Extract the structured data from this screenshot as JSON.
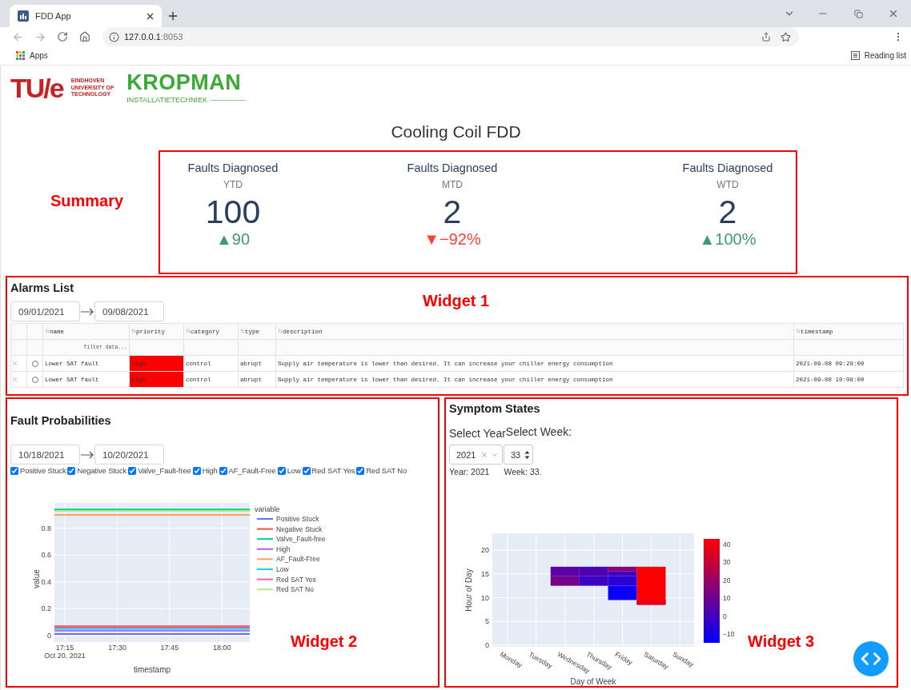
{
  "browser": {
    "tab_title": "FDD App",
    "url_host": "127.0.0.1",
    "url_port": ":8053",
    "bookmark": "Apps",
    "reading_list": "Reading list"
  },
  "header": {
    "tue_mark": "TU/e",
    "tue_lines": [
      "EINDHOVEN",
      "UNIVERSITY OF",
      "TECHNOLOGY"
    ],
    "kropman_name": "KROPMAN",
    "kropman_tagline": "INSTALLATIETECHNIEK"
  },
  "title": "Cooling Coil FDD",
  "summary": {
    "annotation": "Summary",
    "cards": [
      {
        "label": "Faults Diagnosed",
        "period": "YTD",
        "value": "100",
        "delta": "▲90",
        "color": "#3d9970"
      },
      {
        "label": "Faults Diagnosed",
        "period": "MTD",
        "value": "2",
        "delta": "▼−92%",
        "color": "#ff4136"
      },
      {
        "label": "Faults Diagnosed",
        "period": "WTD",
        "value": "2",
        "delta": "▲100%",
        "color": "#3d9970"
      }
    ]
  },
  "alarms": {
    "title": "Alarms List",
    "annotation": "Widget 1",
    "date_start": "09/01/2021",
    "date_end": "09/08/2021",
    "columns": [
      "name",
      "priority",
      "category",
      "type",
      "description",
      "timestamp"
    ],
    "filter_placeholder": "filter data...",
    "rows": [
      {
        "selected": false,
        "highlight_priority": true,
        "cells": [
          "Lower SAT fault",
          "high",
          "control",
          "abrupt",
          "Supply air temperature is lower than desired. It can increase your chiller energy consumption",
          "2021-09-08 09:28:00"
        ]
      },
      {
        "selected": false,
        "highlight_priority": true,
        "cells": [
          "Lower SAT fault",
          "high",
          "control",
          "abrupt",
          "Supply air temperature is lower than desired. It can increase your chiller energy consumption",
          "2021-09-08 10:08:00"
        ]
      }
    ]
  },
  "fault_probabilities": {
    "title": "Fault Probabilities",
    "annotation": "Widget 2",
    "date_start": "10/18/2021",
    "date_end": "10/20/2021",
    "options": [
      {
        "label": "Positive Stuck",
        "checked": true
      },
      {
        "label": "Negative Stuck",
        "checked": true
      },
      {
        "label": "Valve_Fault-free",
        "checked": true
      },
      {
        "label": "High",
        "checked": true
      },
      {
        "label": "AF_Fault-Free",
        "checked": true
      },
      {
        "label": "Low",
        "checked": true
      },
      {
        "label": "Red SAT Yes",
        "checked": true
      },
      {
        "label": "Red SAT No",
        "checked": true
      }
    ],
    "chart_data": {
      "type": "line",
      "xlabel": "timestamp",
      "ylabel": "value",
      "x": [
        17.2,
        18.133
      ],
      "series": [
        {
          "name": "Positive Stuck",
          "color": "#636efa",
          "values": [
            0.01,
            0.01
          ]
        },
        {
          "name": "Negative Stuck",
          "color": "#ef553b",
          "values": [
            0.06,
            0.06
          ]
        },
        {
          "name": "Valve_Fault-free",
          "color": "#00cc96",
          "values": [
            0.94,
            0.94
          ]
        },
        {
          "name": "High",
          "color": "#ab63fa",
          "values": [
            0.035,
            0.035
          ]
        },
        {
          "name": "AF_Fault-Free",
          "color": "#ffa15a",
          "values": [
            0.9,
            0.9
          ]
        },
        {
          "name": "Low",
          "color": "#19d3f3",
          "values": [
            0.05,
            0.05
          ]
        },
        {
          "name": "Red SAT Yes",
          "color": "#ff6692",
          "values": [
            0.07,
            0.07
          ]
        },
        {
          "name": "Red SAT No",
          "color": "#b6e880",
          "values": [
            0.93,
            0.93
          ]
        }
      ],
      "grid": true,
      "legend": {
        "title": "variable"
      },
      "xlim": [
        17.2,
        18.133
      ],
      "ylim": [
        -0.05,
        0.99
      ],
      "xticks": [
        {
          "value": 17.25,
          "label": "17:15"
        },
        {
          "value": 17.5,
          "label": "17:30"
        },
        {
          "value": 17.75,
          "label": "17:45"
        },
        {
          "value": 18,
          "label": "18:00"
        }
      ],
      "yticks": [
        0,
        0.2,
        0.4,
        0.6,
        0.8
      ],
      "annotations": [
        "Oct 20, 2021"
      ]
    }
  },
  "symptom_states": {
    "title": "Symptom States",
    "annotation": "Widget 3",
    "year_label": "Select Year",
    "week_label": "Select Week:",
    "year_value": "2021",
    "week_value": "33",
    "year_readout": "Year: 2021",
    "week_readout": "Week: 33.",
    "heatmap": {
      "xlabel": "Day of Week",
      "ylabel": "Hour of Day",
      "days": [
        "Monday",
        "Tuesday",
        "Wednesday",
        "Thursday",
        "Friday",
        "Saturday",
        "Sunday"
      ],
      "hour_ticks": [
        "20",
        "15",
        "10",
        "5",
        "0"
      ],
      "colorbar_ticks": [
        "40",
        "30",
        "20",
        "10",
        "0",
        "−10"
      ]
    }
  }
}
